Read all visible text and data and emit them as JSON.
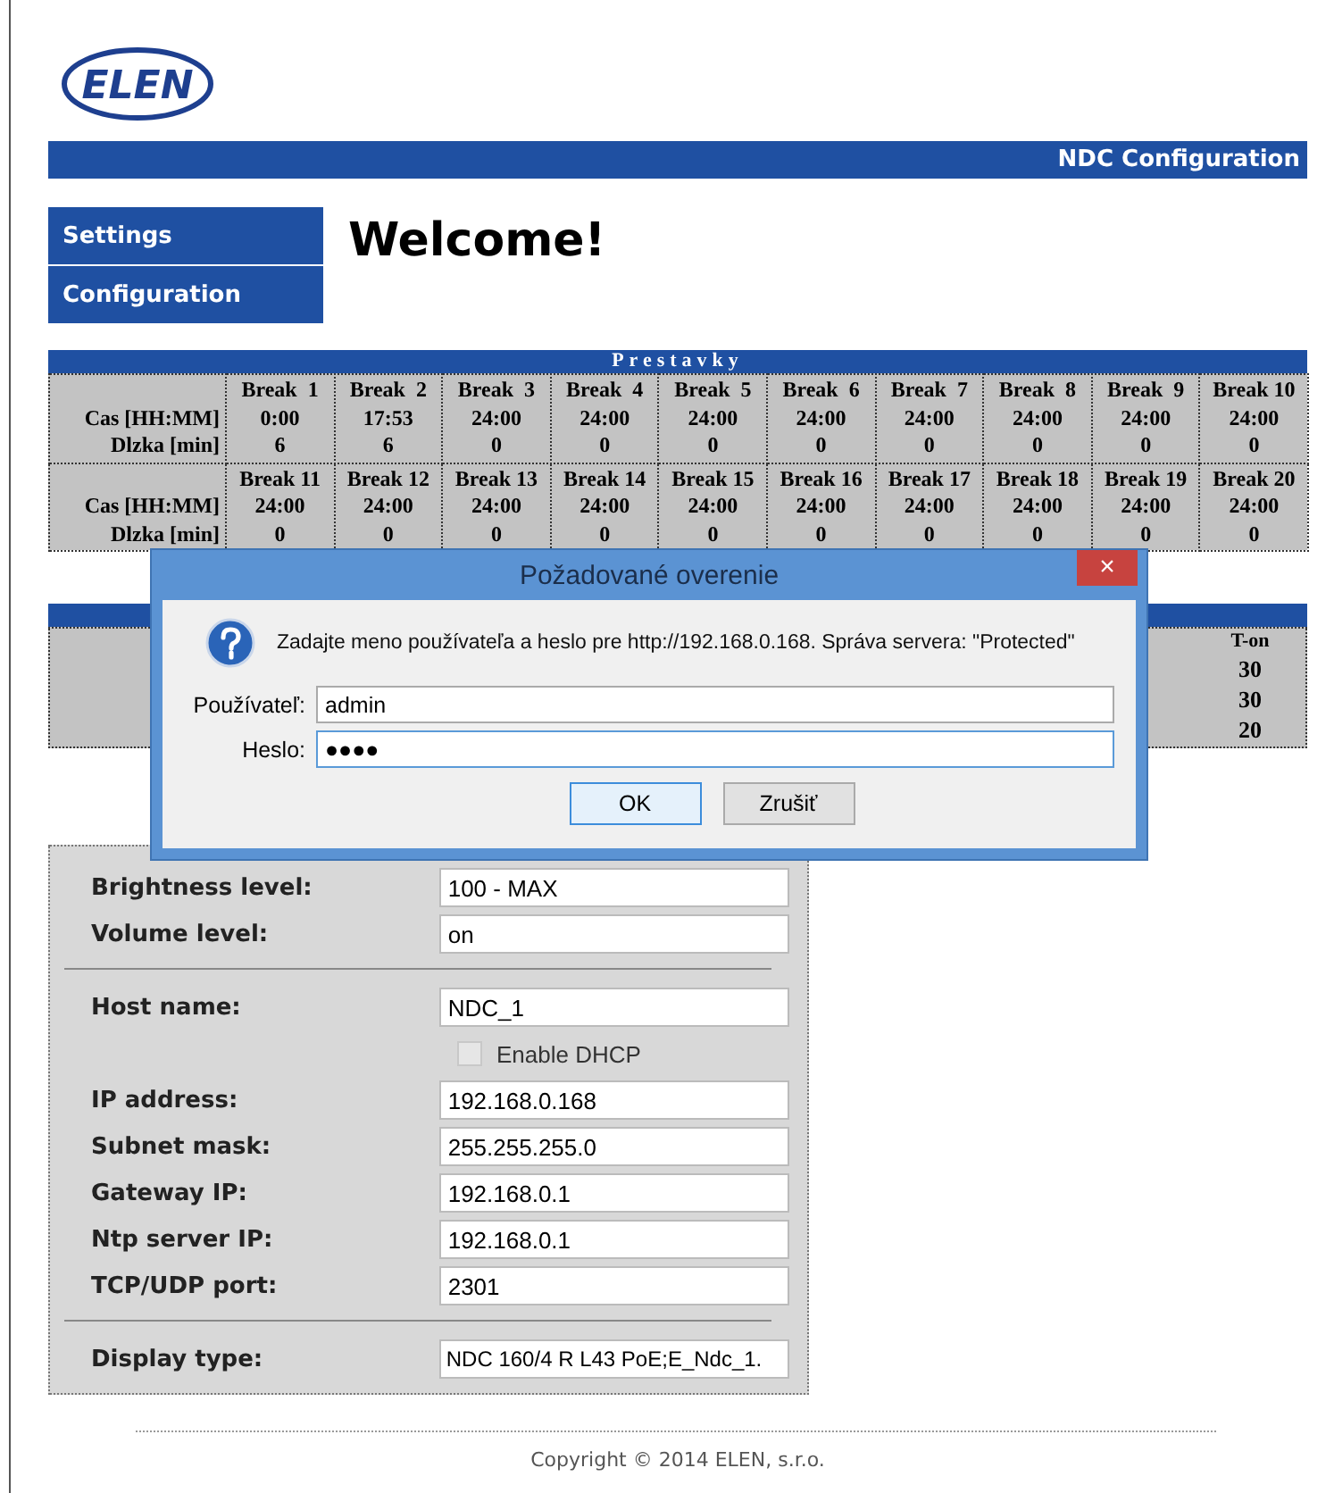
{
  "logo": {
    "text": "ELEN"
  },
  "header_bar": {
    "title": "NDC Configuration"
  },
  "menu": [
    {
      "label": "Settings"
    },
    {
      "label": "Configuration"
    }
  ],
  "heading": "Welcome!",
  "breaks_table": {
    "title": "Prestavky",
    "groups": [
      {
        "row_labels": [
          "Cas [HH:MM]",
          "Dlzka [min]"
        ],
        "breaks": [
          {
            "name": "Break  1",
            "time": "0:00",
            "length": "6"
          },
          {
            "name": "Break  2",
            "time": "17:53",
            "length": "6"
          },
          {
            "name": "Break  3",
            "time": "24:00",
            "length": "0"
          },
          {
            "name": "Break  4",
            "time": "24:00",
            "length": "0"
          },
          {
            "name": "Break  5",
            "time": "24:00",
            "length": "0"
          },
          {
            "name": "Break  6",
            "time": "24:00",
            "length": "0"
          },
          {
            "name": "Break  7",
            "time": "24:00",
            "length": "0"
          },
          {
            "name": "Break  8",
            "time": "24:00",
            "length": "0"
          },
          {
            "name": "Break  9",
            "time": "24:00",
            "length": "0"
          },
          {
            "name": "Break 10",
            "time": "24:00",
            "length": "0"
          }
        ]
      },
      {
        "row_labels": [
          "Cas [HH:MM]",
          "Dlzka [min]"
        ],
        "breaks": [
          {
            "name": "Break 11",
            "time": "24:00",
            "length": "0"
          },
          {
            "name": "Break 12",
            "time": "24:00",
            "length": "0"
          },
          {
            "name": "Break 13",
            "time": "24:00",
            "length": "0"
          },
          {
            "name": "Break 14",
            "time": "24:00",
            "length": "0"
          },
          {
            "name": "Break 15",
            "time": "24:00",
            "length": "0"
          },
          {
            "name": "Break 16",
            "time": "24:00",
            "length": "0"
          },
          {
            "name": "Break 17",
            "time": "24:00",
            "length": "0"
          },
          {
            "name": "Break 18",
            "time": "24:00",
            "length": "0"
          },
          {
            "name": "Break 19",
            "time": "24:00",
            "length": "0"
          },
          {
            "name": "Break 20",
            "time": "24:00",
            "length": "0"
          }
        ]
      }
    ]
  },
  "second_table": {
    "columns": [
      {
        "header": "T-on",
        "values": [
          "30",
          "30",
          "20"
        ]
      }
    ]
  },
  "settings": [
    {
      "kind": "field",
      "label": "Brightness level:",
      "value": "100 - MAX"
    },
    {
      "kind": "field",
      "label": "Volume level:",
      "value": "on"
    },
    {
      "kind": "divider"
    },
    {
      "kind": "field",
      "label": "Host name:",
      "value": "NDC_1"
    },
    {
      "kind": "checkbox",
      "label": "Enable DHCP",
      "checked": false,
      "disabled": true
    },
    {
      "kind": "field",
      "label": "IP address:",
      "value": "192.168.0.168"
    },
    {
      "kind": "field",
      "label": "Subnet mask:",
      "value": "255.255.255.0"
    },
    {
      "kind": "field",
      "label": "Gateway IP:",
      "value": "192.168.0.1"
    },
    {
      "kind": "field",
      "label": "Ntp server IP:",
      "value": "192.168.0.1"
    },
    {
      "kind": "field",
      "label": "TCP/UDP port:",
      "value": "2301"
    },
    {
      "kind": "divider"
    },
    {
      "kind": "field",
      "label": "Display type:",
      "value": "NDC 160/4 R L43 PoE;E_Ndc_1."
    }
  ],
  "footer": {
    "copyright": "Copyright © 2014 ELEN, s.r.o."
  },
  "dialog": {
    "title": "Požadované overenie",
    "close": "×",
    "message": "Zadajte meno používateľa a heslo pre http://192.168.0.168. Správa servera: \"Protected\"",
    "fields": [
      {
        "label": "Používateľ:",
        "value": "admin",
        "focused": false
      },
      {
        "label": "Heslo:",
        "value": "●●●●",
        "focused": true
      }
    ],
    "buttons": [
      {
        "label": "OK",
        "default": true
      },
      {
        "label": "Zrušiť",
        "default": false
      }
    ]
  }
}
